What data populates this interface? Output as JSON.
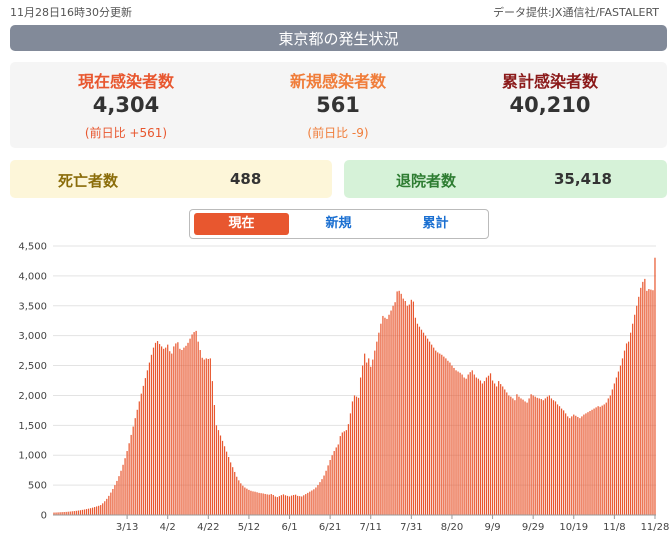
{
  "header": {
    "updated": "11月28日16時30分更新",
    "source": "データ提供:JX通信社/FASTALERT"
  },
  "title": "東京都の発生状況",
  "stats": [
    {
      "label": "現在感染者数",
      "value": "4,304",
      "diff": "(前日比 +561)"
    },
    {
      "label": "新規感染者数",
      "value": "561",
      "diff": "(前日比 -9)"
    },
    {
      "label": "累計感染者数",
      "value": "40,210"
    }
  ],
  "deaths": {
    "label": "死亡者数",
    "value": "488"
  },
  "recovered": {
    "label": "退院者数",
    "value": "35,418"
  },
  "tabs": [
    "現在",
    "新規",
    "累計"
  ],
  "colors": {
    "accent": "#e8572f",
    "header_bar": "#828a99",
    "tab_link": "#1a6fd1"
  },
  "chart_data": {
    "type": "bar",
    "series": [
      {
        "values": [
          41,
          42,
          44,
          46,
          48,
          50,
          52,
          55,
          58,
          62,
          66,
          70,
          75,
          80,
          86,
          92,
          99,
          106,
          114,
          123,
          133,
          143,
          154,
          166,
          195,
          230,
          270,
          320,
          375,
          435,
          500,
          570,
          650,
          740,
          840,
          950,
          1070,
          1200,
          1340,
          1480,
          1620,
          1760,
          1900,
          2030,
          2160,
          2290,
          2420,
          2550,
          2680,
          2800,
          2880,
          2910,
          2860,
          2820,
          2780,
          2800,
          2850,
          2740,
          2700,
          2820,
          2870,
          2890,
          2780,
          2760,
          2800,
          2830,
          2880,
          2950,
          3020,
          3060,
          3080,
          2900,
          2760,
          2630,
          2600,
          2620,
          2610,
          2620,
          2240,
          1840,
          1500,
          1420,
          1330,
          1240,
          1150,
          1060,
          970,
          880,
          800,
          720,
          640,
          580,
          530,
          490,
          460,
          440,
          420,
          405,
          395,
          390,
          380,
          370,
          365,
          360,
          352,
          345,
          340,
          350,
          335,
          310,
          300,
          315,
          332,
          345,
          330,
          320,
          310,
          325,
          335,
          340,
          320,
          315,
          310,
          330,
          350,
          370,
          390,
          410,
          430,
          460,
          500,
          550,
          600,
          660,
          740,
          830,
          920,
          1000,
          1070,
          1130,
          1180,
          1320,
          1380,
          1400,
          1420,
          1520,
          1700,
          1900,
          2000,
          1980,
          1960,
          2300,
          2500,
          2700,
          2550,
          2620,
          2480,
          2600,
          2750,
          2900,
          3050,
          3200,
          3330,
          3300,
          3280,
          3350,
          3420,
          3500,
          3560,
          3740,
          3750,
          3700,
          3620,
          3580,
          3500,
          3520,
          3600,
          3570,
          3300,
          3200,
          3150,
          3100,
          3050,
          3000,
          2950,
          2900,
          2850,
          2800,
          2750,
          2720,
          2700,
          2680,
          2650,
          2620,
          2580,
          2550,
          2500,
          2460,
          2420,
          2400,
          2380,
          2350,
          2300,
          2280,
          2350,
          2390,
          2420,
          2350,
          2300,
          2280,
          2250,
          2200,
          2240,
          2300,
          2330,
          2370,
          2250,
          2200,
          2150,
          2240,
          2190,
          2150,
          2100,
          2050,
          2000,
          1980,
          1950,
          1920,
          2020,
          1980,
          1950,
          1930,
          1900,
          1880,
          1950,
          2020,
          2000,
          1980,
          1960,
          1950,
          1940,
          1920,
          1950,
          1980,
          2000,
          1950,
          1920,
          1900,
          1850,
          1820,
          1780,
          1750,
          1700,
          1650,
          1620,
          1650,
          1680,
          1660,
          1640,
          1620,
          1650,
          1680,
          1700,
          1720,
          1740,
          1760,
          1780,
          1800,
          1820,
          1810,
          1830,
          1850,
          1880,
          1950,
          2000,
          2100,
          2200,
          2300,
          2400,
          2500,
          2620,
          2750,
          2870,
          2900,
          3050,
          3200,
          3350,
          3500,
          3650,
          3800,
          3900,
          3950,
          3750,
          3780,
          3770,
          3760,
          4304
        ]
      }
    ],
    "xticks": [
      "3/13",
      "4/2",
      "4/22",
      "5/12",
      "6/1",
      "6/21",
      "7/11",
      "7/31",
      "8/20",
      "9/9",
      "9/29",
      "10/19",
      "11/8",
      "11/28"
    ],
    "ylim": [
      0,
      4500
    ],
    "yticks": [
      "0",
      "500",
      "1,000",
      "1,500",
      "2,000",
      "2,500",
      "3,000",
      "3,500",
      "4,000",
      "4,500"
    ],
    "grid": true
  }
}
